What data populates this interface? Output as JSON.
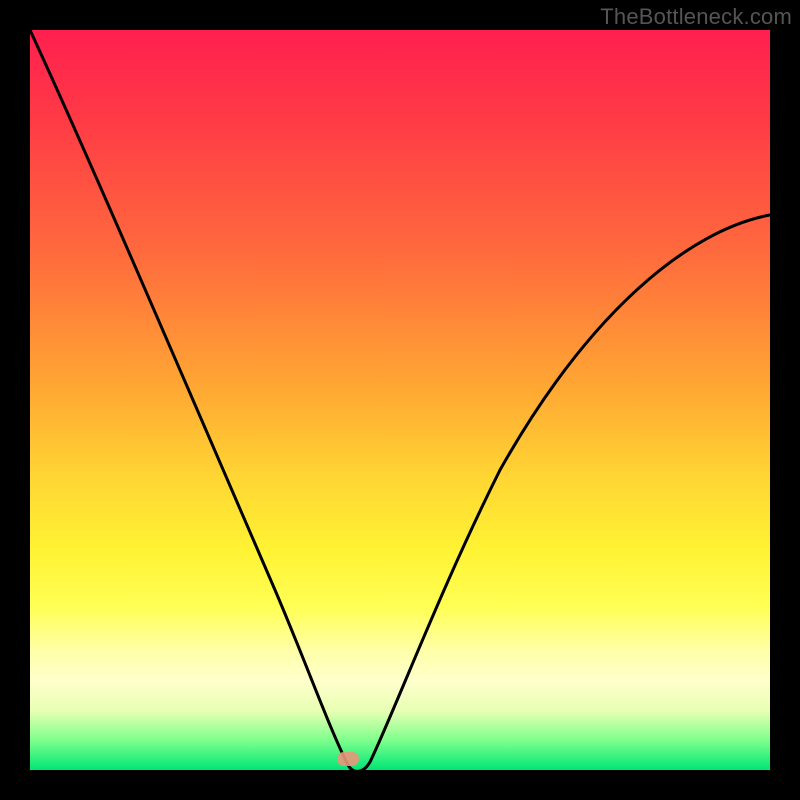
{
  "attribution": "TheBottleneck.com",
  "marker": {
    "x_frac": 0.43,
    "y_frac": 0.987
  },
  "chart_data": {
    "type": "line",
    "title": "",
    "xlabel": "",
    "ylabel": "",
    "xlim": [
      0,
      1
    ],
    "ylim": [
      0,
      1
    ],
    "series": [
      {
        "name": "bottleneck-curve",
        "x": [
          0.0,
          0.05,
          0.1,
          0.15,
          0.2,
          0.25,
          0.3,
          0.35,
          0.38,
          0.41,
          0.43,
          0.45,
          0.48,
          0.52,
          0.58,
          0.65,
          0.72,
          0.8,
          0.88,
          0.95,
          1.0
        ],
        "y": [
          1.0,
          0.88,
          0.76,
          0.64,
          0.52,
          0.4,
          0.28,
          0.15,
          0.08,
          0.03,
          0.0,
          0.02,
          0.06,
          0.14,
          0.26,
          0.38,
          0.48,
          0.57,
          0.65,
          0.71,
          0.75
        ]
      }
    ],
    "background_gradient": {
      "top": "#ff1f4f",
      "mid": "#fff233",
      "bottom": "#00e676"
    }
  }
}
